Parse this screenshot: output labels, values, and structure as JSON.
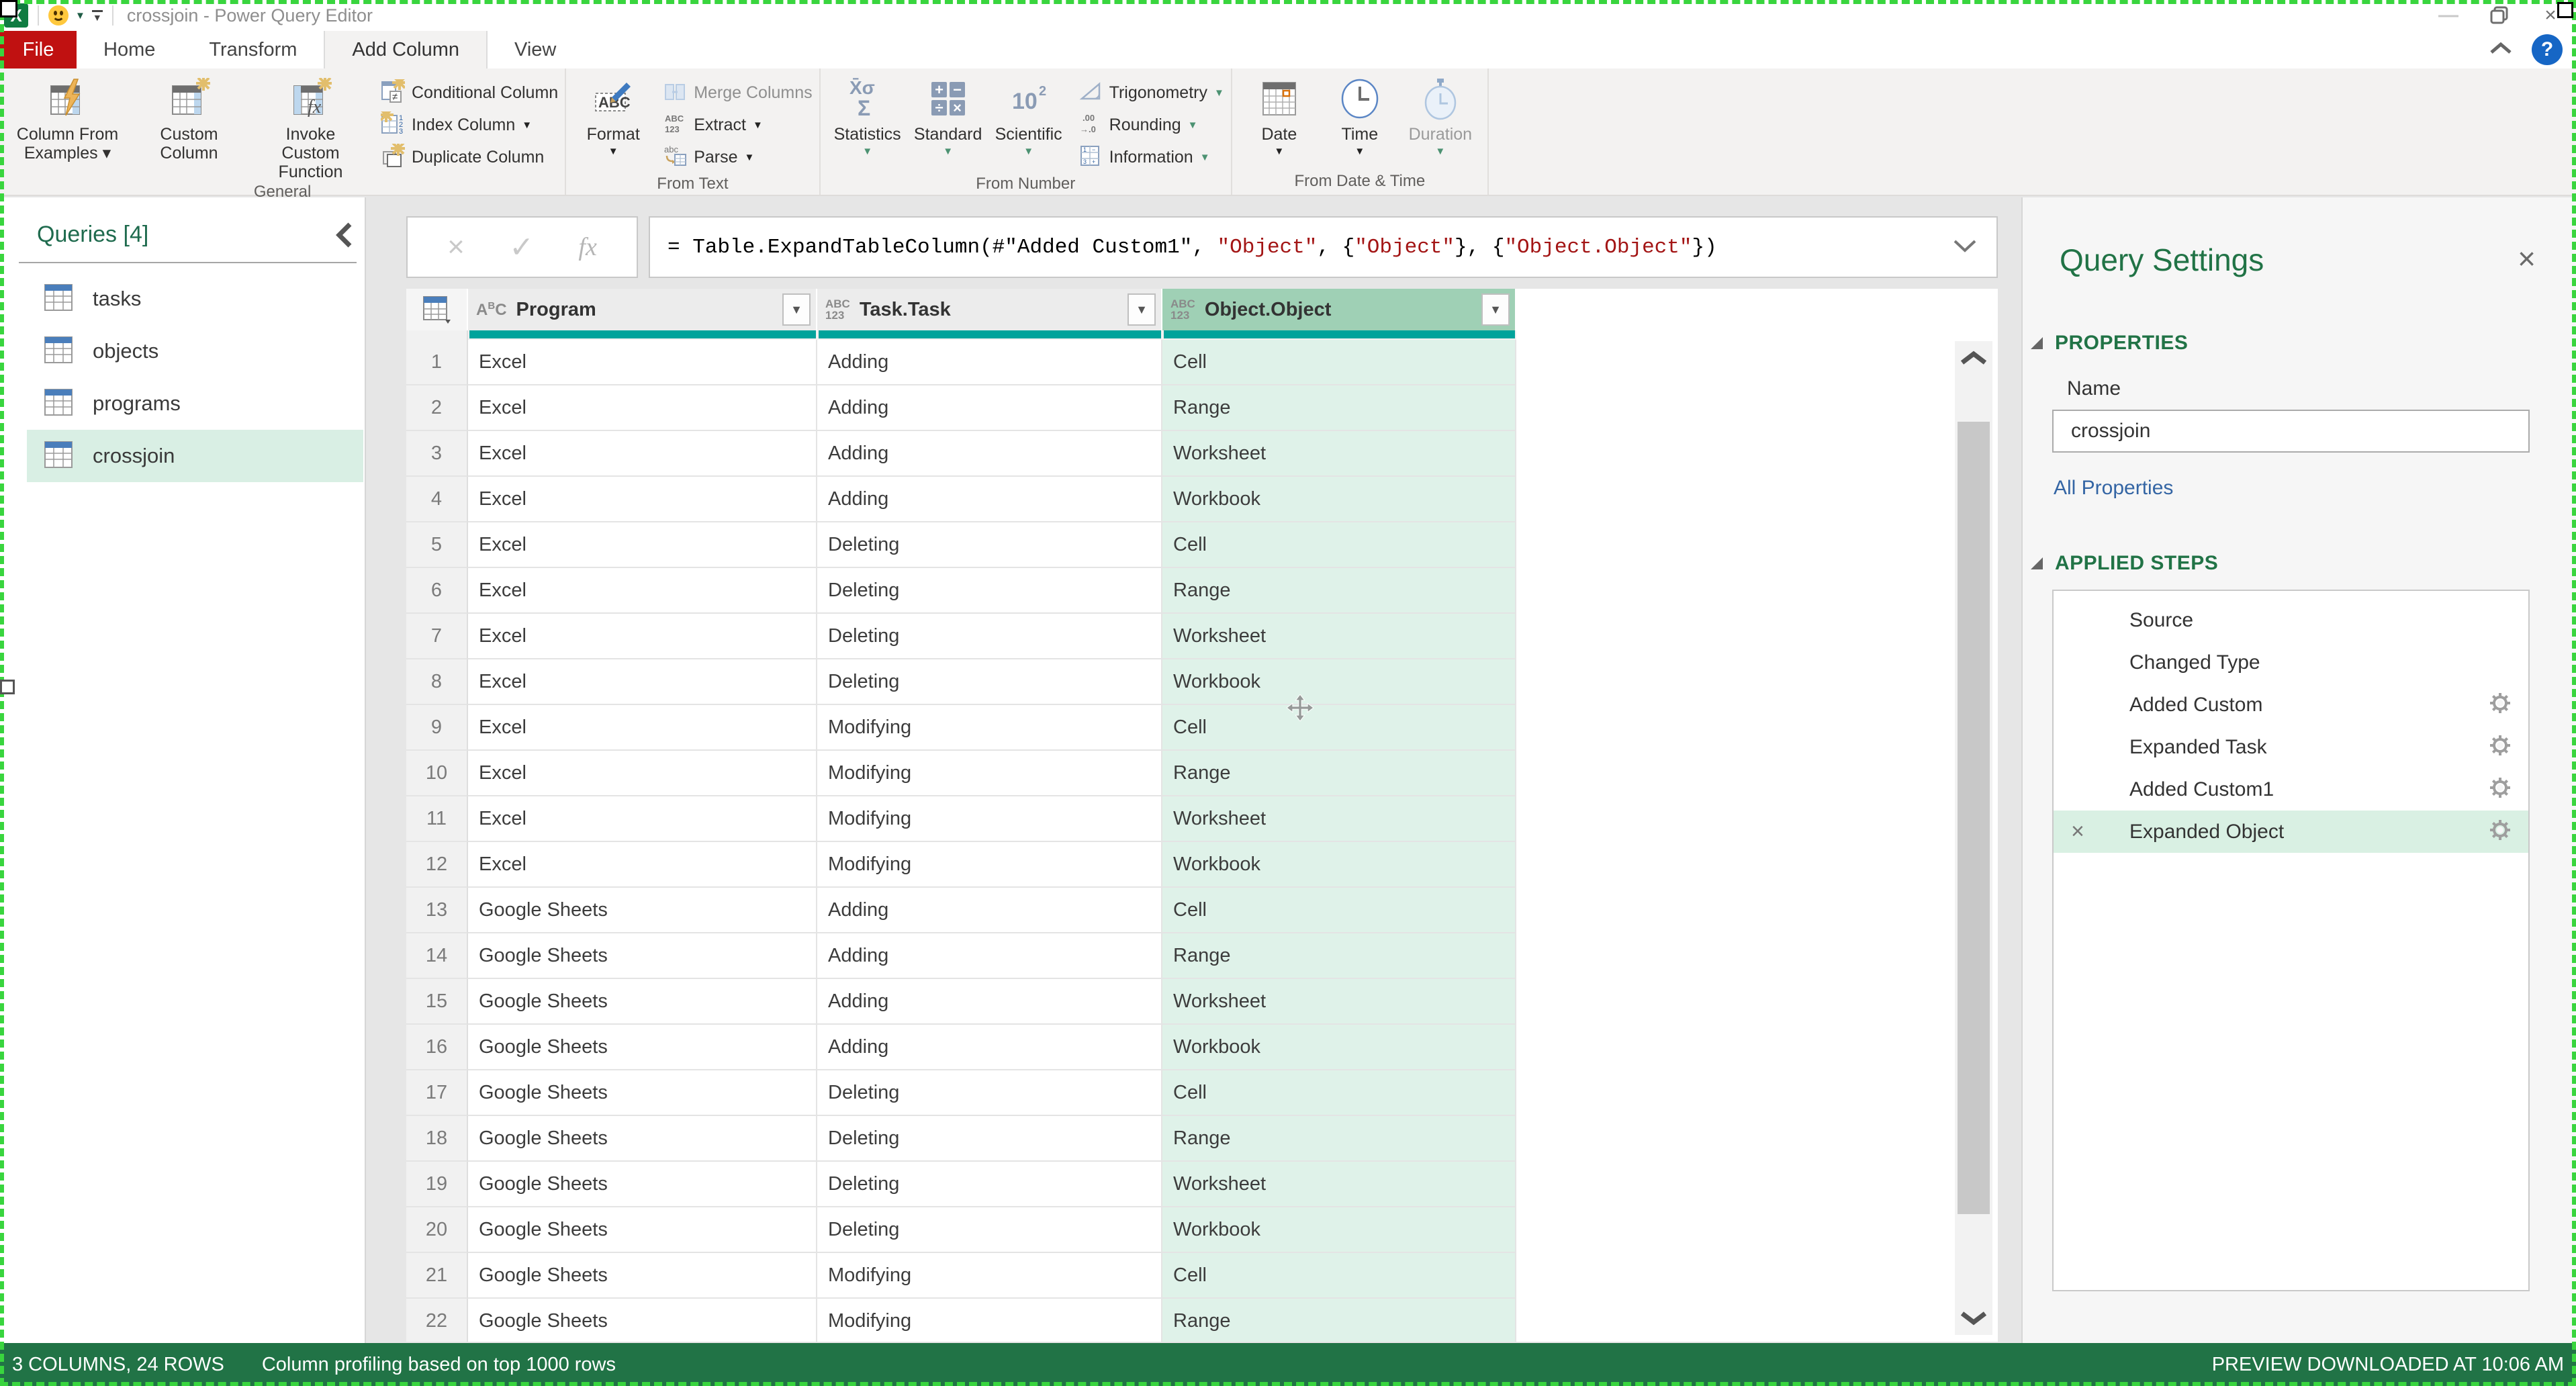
{
  "window": {
    "title": "crossjoin - Power Query Editor",
    "app_icon": "X",
    "minimize_label": "—",
    "close_label": "×",
    "help_label": "?"
  },
  "colors": {
    "excel_green": "#217346",
    "file_tab_red": "#C01111",
    "quality_bar_teal": "#00A39B",
    "selected_header_green": "#9FD0B5",
    "selected_cell_green": "#DFF2E9",
    "selected_item_green": "#D9EFE4",
    "formula_string_red": "#A31515",
    "help_blue": "#1666C5"
  },
  "ribbon": {
    "tabs": [
      {
        "label": "File",
        "file": true,
        "active": false
      },
      {
        "label": "Home",
        "active": false
      },
      {
        "label": "Transform",
        "active": false
      },
      {
        "label": "Add Column",
        "active": true
      },
      {
        "label": "View",
        "active": false
      }
    ],
    "groups": [
      {
        "label": "General",
        "big": [
          {
            "label": "Column From Examples ▾",
            "icon": "table-lightning-icon"
          },
          {
            "label": "Custom Column",
            "icon": "table-star-icon"
          },
          {
            "label": "Invoke Custom Function",
            "icon": "table-fx-icon"
          }
        ],
        "small": [
          {
            "label": "Conditional Column",
            "icon": "grid-notequal-icon"
          },
          {
            "label": "Index Column",
            "dropdown": "#222",
            "icon": "grid-123-icon"
          },
          {
            "label": "Duplicate Column",
            "icon": "copy-star-icon"
          }
        ]
      },
      {
        "label": "From Text",
        "big": [
          {
            "label": "Format",
            "dropdown": "#222",
            "icon": "abc-pencil-icon"
          }
        ],
        "small": [
          {
            "label": "Merge Columns",
            "disabled": true,
            "icon": "merge-columns-icon"
          },
          {
            "label": "Extract",
            "dropdown": "#222",
            "icon": "abc123-icon"
          },
          {
            "label": "Parse",
            "dropdown": "#222",
            "icon": "parse-icon"
          }
        ]
      },
      {
        "label": "From Number",
        "big": [
          {
            "label": "Statistics",
            "dropdown": "#4C9272",
            "icon": "statistics-sigma-icon"
          },
          {
            "label": "Standard",
            "dropdown": "#4C9272",
            "icon": "operators-icon"
          },
          {
            "label": "Scientific",
            "dropdown": "#4C9272",
            "icon": "ten-squared-icon"
          }
        ],
        "small": [
          {
            "label": "Trigonometry",
            "dropdown": "#4C9272",
            "icon": "triangle-icon"
          },
          {
            "label": "Rounding",
            "dropdown": "#4C9272",
            "icon": "rounding-icon"
          },
          {
            "label": "Information",
            "dropdown": "#4C9272",
            "icon": "information-grid-icon"
          }
        ]
      },
      {
        "label": "From Date & Time",
        "big": [
          {
            "label": "Date",
            "dropdown": "#222",
            "icon": "calendar-icon"
          },
          {
            "label": "Time",
            "dropdown": "#222",
            "icon": "clock-icon"
          },
          {
            "label": "Duration",
            "dropdown": "#4C9272",
            "disabled": true,
            "icon": "stopwatch-icon"
          }
        ],
        "small": []
      }
    ]
  },
  "formula_bar": {
    "tokens": [
      {
        "text": "= Table.ExpandTableColumn(#\"Added Custom1\", ",
        "type": "plain"
      },
      {
        "text": "\"Object\"",
        "type": "string"
      },
      {
        "text": ", {",
        "type": "plain"
      },
      {
        "text": "\"Object\"",
        "type": "string"
      },
      {
        "text": "}, {",
        "type": "plain"
      },
      {
        "text": "\"Object.Object\"",
        "type": "string"
      },
      {
        "text": "})",
        "type": "plain"
      }
    ]
  },
  "queries_panel": {
    "title": "Queries [4]",
    "items": [
      {
        "name": "tasks",
        "selected": false
      },
      {
        "name": "objects",
        "selected": false
      },
      {
        "name": "programs",
        "selected": false
      },
      {
        "name": "crossjoin",
        "selected": true
      }
    ]
  },
  "table": {
    "columns": [
      {
        "name": "Program",
        "type": "text",
        "selected": false
      },
      {
        "name": "Task.Task",
        "type": "any",
        "selected": false
      },
      {
        "name": "Object.Object",
        "type": "any",
        "selected": true
      }
    ],
    "rows": [
      {
        "num": 1,
        "cells": [
          "Excel",
          "Adding",
          "Cell"
        ]
      },
      {
        "num": 2,
        "cells": [
          "Excel",
          "Adding",
          "Range"
        ]
      },
      {
        "num": 3,
        "cells": [
          "Excel",
          "Adding",
          "Worksheet"
        ]
      },
      {
        "num": 4,
        "cells": [
          "Excel",
          "Adding",
          "Workbook"
        ]
      },
      {
        "num": 5,
        "cells": [
          "Excel",
          "Deleting",
          "Cell"
        ]
      },
      {
        "num": 6,
        "cells": [
          "Excel",
          "Deleting",
          "Range"
        ]
      },
      {
        "num": 7,
        "cells": [
          "Excel",
          "Deleting",
          "Worksheet"
        ]
      },
      {
        "num": 8,
        "cells": [
          "Excel",
          "Deleting",
          "Workbook"
        ]
      },
      {
        "num": 9,
        "cells": [
          "Excel",
          "Modifying",
          "Cell"
        ]
      },
      {
        "num": 10,
        "cells": [
          "Excel",
          "Modifying",
          "Range"
        ]
      },
      {
        "num": 11,
        "cells": [
          "Excel",
          "Modifying",
          "Worksheet"
        ]
      },
      {
        "num": 12,
        "cells": [
          "Excel",
          "Modifying",
          "Workbook"
        ]
      },
      {
        "num": 13,
        "cells": [
          "Google Sheets",
          "Adding",
          "Cell"
        ]
      },
      {
        "num": 14,
        "cells": [
          "Google Sheets",
          "Adding",
          "Range"
        ]
      },
      {
        "num": 15,
        "cells": [
          "Google Sheets",
          "Adding",
          "Worksheet"
        ]
      },
      {
        "num": 16,
        "cells": [
          "Google Sheets",
          "Adding",
          "Workbook"
        ]
      },
      {
        "num": 17,
        "cells": [
          "Google Sheets",
          "Deleting",
          "Cell"
        ]
      },
      {
        "num": 18,
        "cells": [
          "Google Sheets",
          "Deleting",
          "Range"
        ]
      },
      {
        "num": 19,
        "cells": [
          "Google Sheets",
          "Deleting",
          "Worksheet"
        ]
      },
      {
        "num": 20,
        "cells": [
          "Google Sheets",
          "Deleting",
          "Workbook"
        ]
      },
      {
        "num": 21,
        "cells": [
          "Google Sheets",
          "Modifying",
          "Cell"
        ]
      },
      {
        "num": 22,
        "cells": [
          "Google Sheets",
          "Modifying",
          "Range"
        ]
      }
    ]
  },
  "query_settings": {
    "title": "Query Settings",
    "properties_label": "PROPERTIES",
    "name_label": "Name",
    "name_value": "crossjoin",
    "all_properties_label": "All Properties",
    "applied_steps_label": "APPLIED STEPS",
    "steps": [
      {
        "name": "Source",
        "gear": false,
        "selected": false
      },
      {
        "name": "Changed Type",
        "gear": false,
        "selected": false
      },
      {
        "name": "Added Custom",
        "gear": true,
        "selected": false
      },
      {
        "name": "Expanded Task",
        "gear": true,
        "selected": false
      },
      {
        "name": "Added Custom1",
        "gear": true,
        "selected": false
      },
      {
        "name": "Expanded Object",
        "gear": true,
        "selected": true,
        "deletable": true
      }
    ]
  },
  "status_bar": {
    "left": "3 COLUMNS, 24 ROWS",
    "center": "Column profiling based on top 1000 rows",
    "right": "PREVIEW DOWNLOADED AT 10:06 AM"
  }
}
